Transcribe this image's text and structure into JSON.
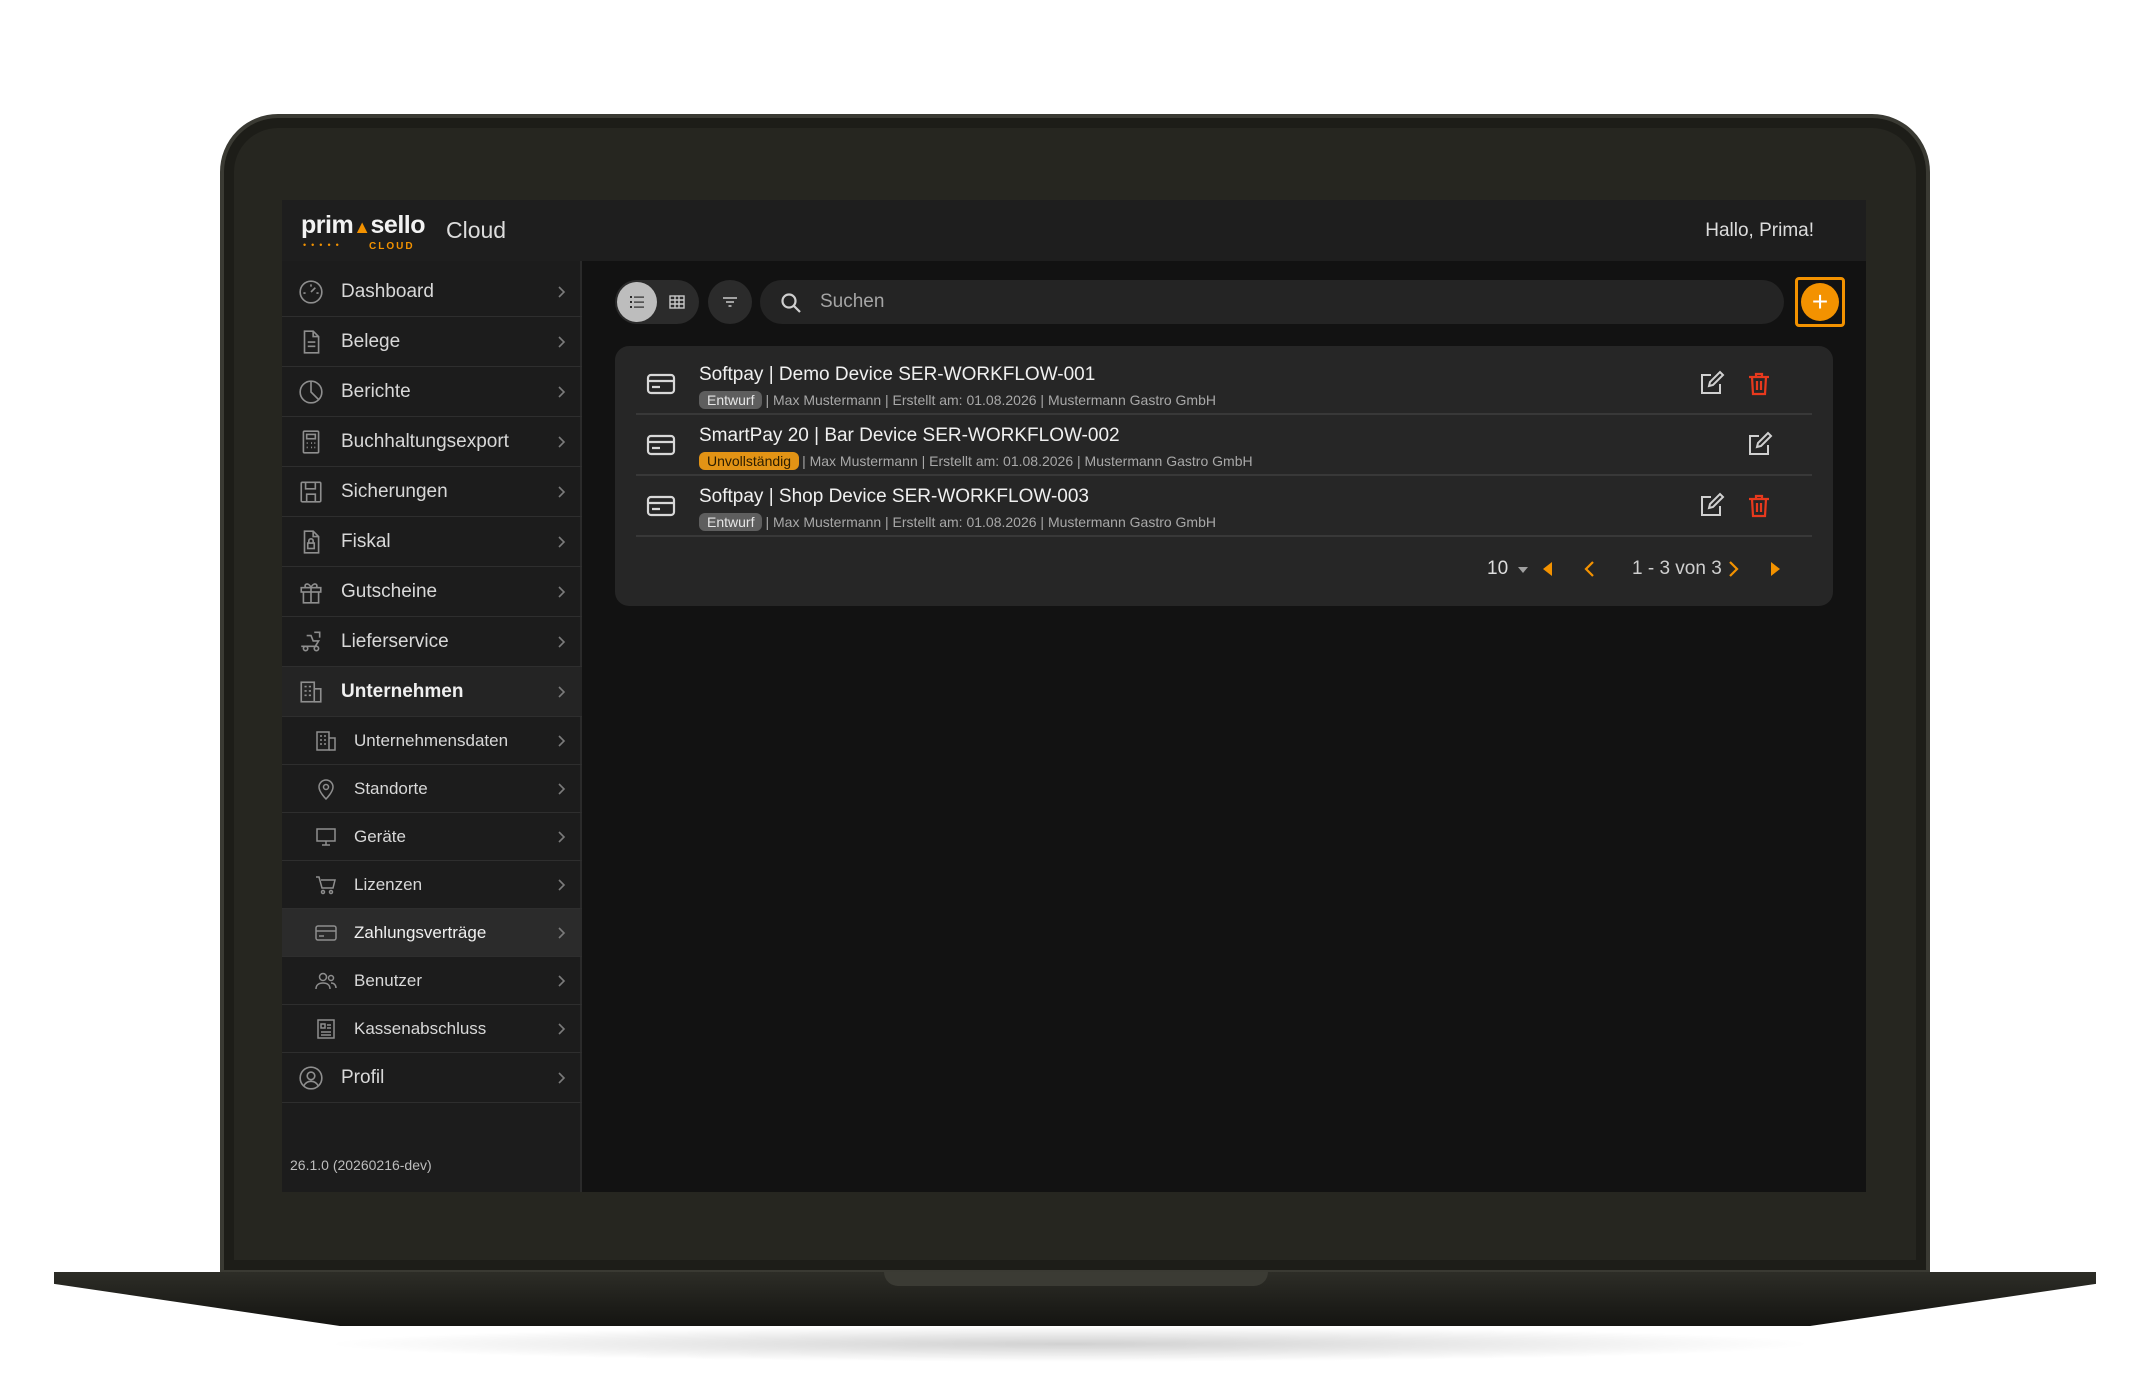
{
  "app": {
    "logo_text_left": "prim",
    "logo_text_right": "sello",
    "logo_sub": "CLOUD",
    "title": "Cloud",
    "greeting": "Hallo, Prima!"
  },
  "sidebar": {
    "items": [
      {
        "label": "Dashboard",
        "icon": "gauge-icon"
      },
      {
        "label": "Belege",
        "icon": "document-icon"
      },
      {
        "label": "Berichte",
        "icon": "pie-chart-icon"
      },
      {
        "label": "Buchhaltungsexport",
        "icon": "calculator-icon"
      },
      {
        "label": "Sicherungen",
        "icon": "save-icon"
      },
      {
        "label": "Fiskal",
        "icon": "lock-document-icon"
      },
      {
        "label": "Gutscheine",
        "icon": "gift-icon"
      },
      {
        "label": "Lieferservice",
        "icon": "delivery-icon"
      },
      {
        "label": "Unternehmen",
        "icon": "building-icon"
      }
    ],
    "sub_items": [
      {
        "label": "Unternehmensdaten",
        "icon": "building-icon"
      },
      {
        "label": "Standorte",
        "icon": "location-pin-icon"
      },
      {
        "label": "Geräte",
        "icon": "monitor-icon"
      },
      {
        "label": "Lizenzen",
        "icon": "cart-icon"
      },
      {
        "label": "Zahlungsverträge",
        "icon": "credit-card-icon"
      },
      {
        "label": "Benutzer",
        "icon": "users-icon"
      },
      {
        "label": "Kassenabschluss",
        "icon": "receipt-icon"
      }
    ],
    "profile": {
      "label": "Profil",
      "icon": "user-circle-icon"
    },
    "version": "26.1.0 (20260216-dev)"
  },
  "toolbar": {
    "search_placeholder": "Suchen",
    "add_label": "+"
  },
  "list": {
    "rows": [
      {
        "title": "Softpay | Demo Device SER-WORKFLOW-001",
        "status": "Entwurf",
        "meta": "| Max Mustermann | Erstellt am: 01.08.2026 | Mustermann Gastro GmbH",
        "deletable": true
      },
      {
        "title": "SmartPay 20 | Bar Device SER-WORKFLOW-002",
        "status": "Unvollständig",
        "meta": "| Max Mustermann | Erstellt am: 01.08.2026 | Mustermann Gastro GmbH",
        "deletable": false
      },
      {
        "title": "Softpay | Shop Device SER-WORKFLOW-003",
        "status": "Entwurf",
        "meta": "| Max Mustermann | Erstellt am: 01.08.2026 | Mustermann Gastro GmbH",
        "deletable": true
      }
    ],
    "pagination": {
      "page_size": "10",
      "info": "1 - 3 von 3"
    }
  },
  "colors": {
    "accent": "#f39200",
    "danger": "#e8391d",
    "background": "#121212",
    "sidebar": "#1c1c1c"
  }
}
